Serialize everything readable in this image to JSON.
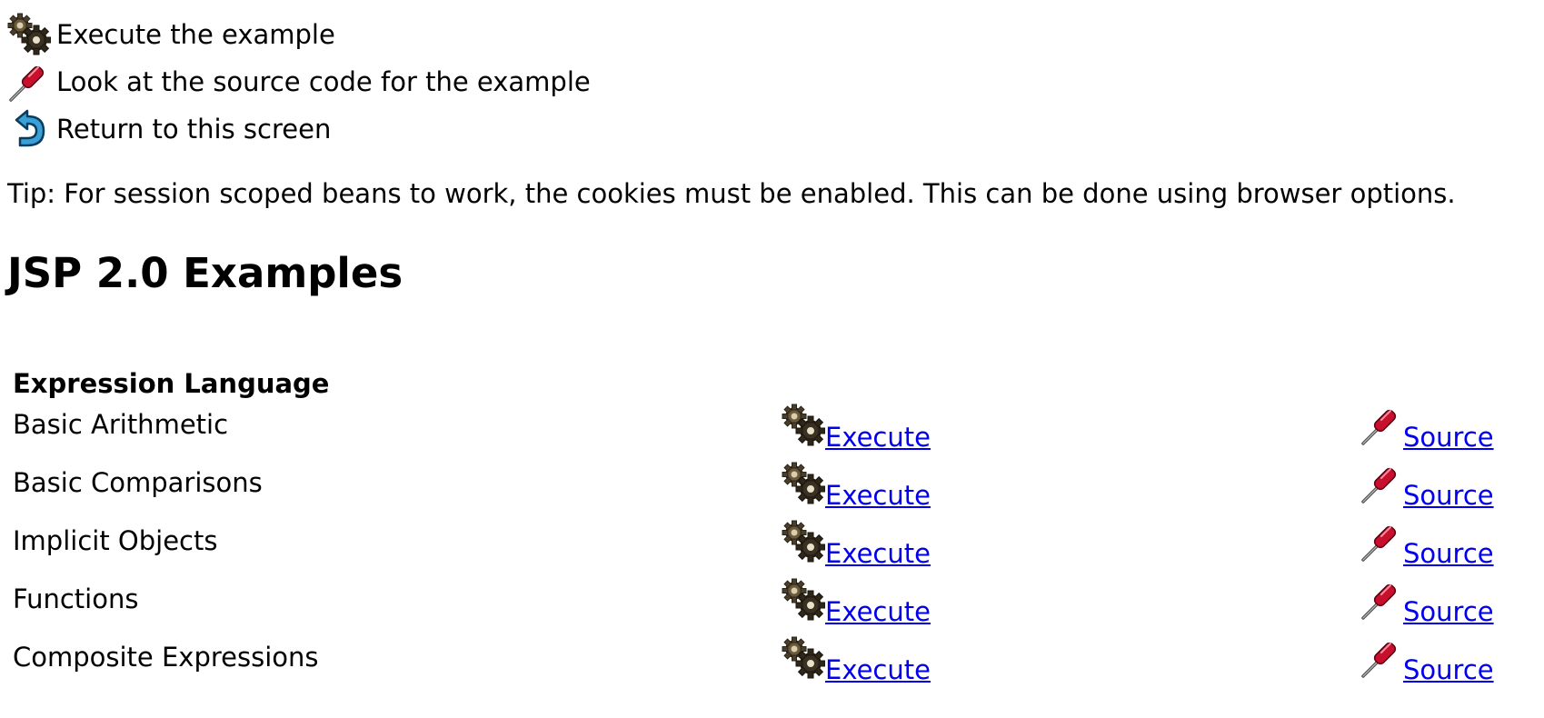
{
  "legend": {
    "items": [
      {
        "icon": "execute-icon",
        "label": "Execute the example"
      },
      {
        "icon": "source-icon",
        "label": "Look at the source code for the example"
      },
      {
        "icon": "return-icon",
        "label": "Return to this screen"
      }
    ]
  },
  "tip": "Tip: For session scoped beans to work, the cookies must be enabled. This can be done using browser options.",
  "page_title": "JSP 2.0 Examples",
  "section": {
    "title": "Expression Language",
    "examples": [
      {
        "name": "Basic Arithmetic",
        "execute_label": "Execute",
        "source_label": "Source"
      },
      {
        "name": "Basic Comparisons",
        "execute_label": "Execute",
        "source_label": "Source"
      },
      {
        "name": "Implicit Objects",
        "execute_label": "Execute",
        "source_label": "Source"
      },
      {
        "name": "Functions",
        "execute_label": "Execute",
        "source_label": "Source"
      },
      {
        "name": "Composite Expressions",
        "execute_label": "Execute",
        "source_label": "Source"
      }
    ]
  },
  "colors": {
    "link": "#0000ee",
    "screwdriver_handle": "#c8102e",
    "return_arrow": "#3aa0d8"
  }
}
